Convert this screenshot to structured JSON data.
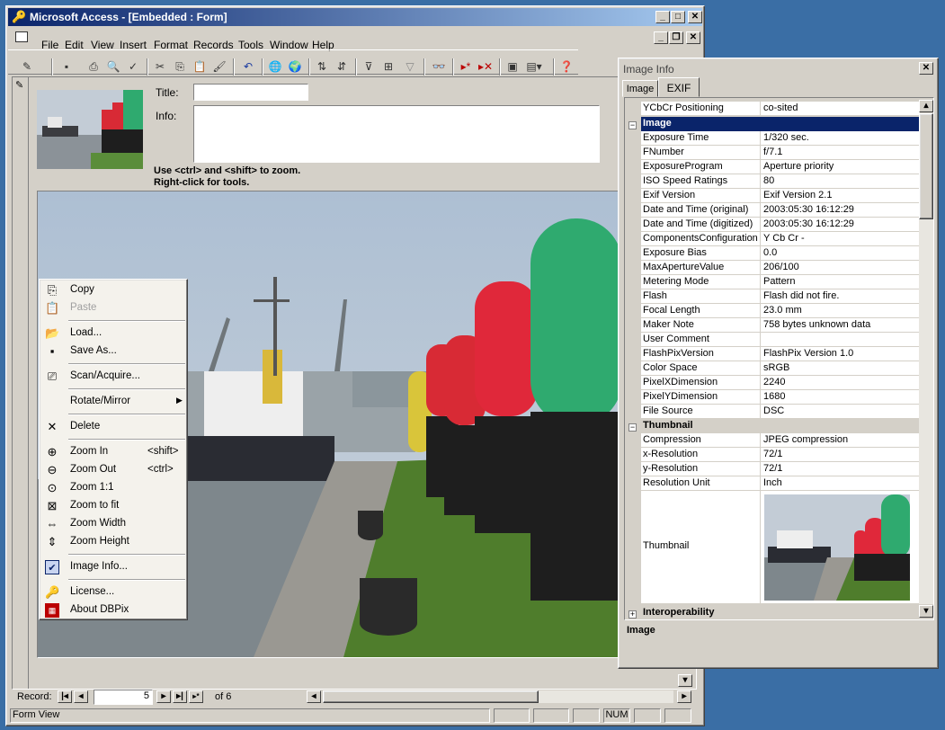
{
  "access": {
    "title": "Microsoft Access - [Embedded : Form]",
    "menu": [
      "File",
      "Edit",
      "View",
      "Insert",
      "Format",
      "Records",
      "Tools",
      "Window",
      "Help"
    ]
  },
  "form": {
    "title_label": "Title:",
    "info_label": "Info:",
    "title_value": "",
    "info_value": "",
    "hint_line1": "Use <ctrl> and <shift> to zoom.",
    "hint_line2": "Right-click for tools."
  },
  "context_menu": {
    "copy": "Copy",
    "paste": "Paste",
    "load": "Load...",
    "save_as": "Save As...",
    "scan": "Scan/Acquire...",
    "rotate": "Rotate/Mirror",
    "delete": "Delete",
    "zoom_in": "Zoom In",
    "zoom_in_sc": "<shift>",
    "zoom_out": "Zoom Out",
    "zoom_out_sc": "<ctrl>",
    "zoom_11": "Zoom 1:1",
    "zoom_fit": "Zoom to fit",
    "zoom_width": "Zoom Width",
    "zoom_height": "Zoom Height",
    "image_info": "Image Info...",
    "license": "License...",
    "about": "About DBPix"
  },
  "record_nav": {
    "label": "Record:",
    "current": "5",
    "of_text": "of  6"
  },
  "status": {
    "text": "Form View",
    "num": "NUM"
  },
  "image_info": {
    "title": "Image Info",
    "tabs": [
      "Image",
      "EXIF"
    ],
    "rows_top": [
      {
        "k": "YCbCr Positioning",
        "v": "co-sited"
      }
    ],
    "cat_image": "Image",
    "rows_image": [
      {
        "k": "Exposure Time",
        "v": "1/320 sec."
      },
      {
        "k": "FNumber",
        "v": "f/7.1"
      },
      {
        "k": "ExposureProgram",
        "v": "Aperture priority"
      },
      {
        "k": "ISO Speed Ratings",
        "v": "80"
      },
      {
        "k": "Exif Version",
        "v": "Exif Version 2.1"
      },
      {
        "k": "Date and Time (original)",
        "v": "2003:05:30 16:12:29"
      },
      {
        "k": "Date and Time (digitized)",
        "v": "2003:05:30 16:12:29"
      },
      {
        "k": "ComponentsConfiguration",
        "v": "Y Cb Cr -"
      },
      {
        "k": "Exposure Bias",
        "v": "0.0"
      },
      {
        "k": "MaxApertureValue",
        "v": "206/100"
      },
      {
        "k": "Metering Mode",
        "v": "Pattern"
      },
      {
        "k": "Flash",
        "v": "Flash did not fire."
      },
      {
        "k": "Focal Length",
        "v": "23.0 mm"
      },
      {
        "k": "Maker Note",
        "v": "758 bytes unknown data"
      },
      {
        "k": "User Comment",
        "v": ""
      },
      {
        "k": "FlashPixVersion",
        "v": "FlashPix Version 1.0"
      },
      {
        "k": "Color Space",
        "v": "sRGB"
      },
      {
        "k": "PixelXDimension",
        "v": "2240"
      },
      {
        "k": "PixelYDimension",
        "v": "1680"
      },
      {
        "k": "File Source",
        "v": "DSC"
      }
    ],
    "cat_thumbnail": "Thumbnail",
    "rows_thumb": [
      {
        "k": "Compression",
        "v": "JPEG compression"
      },
      {
        "k": "x-Resolution",
        "v": "72/1"
      },
      {
        "k": "y-Resolution",
        "v": "72/1"
      },
      {
        "k": "Resolution Unit",
        "v": "Inch"
      }
    ],
    "thumbnail_label": "Thumbnail",
    "cat_interop": "Interoperability",
    "description": "Image"
  },
  "colors": {
    "title_gradient_start": "#0a246a",
    "title_gradient_end": "#a6caf0",
    "selected_category": "#0a246a",
    "desktop": "#3a6ea5",
    "buoy_green": "#2faa6f",
    "buoy_red": "#e0283a",
    "buoy_black": "#1e1e1e"
  }
}
